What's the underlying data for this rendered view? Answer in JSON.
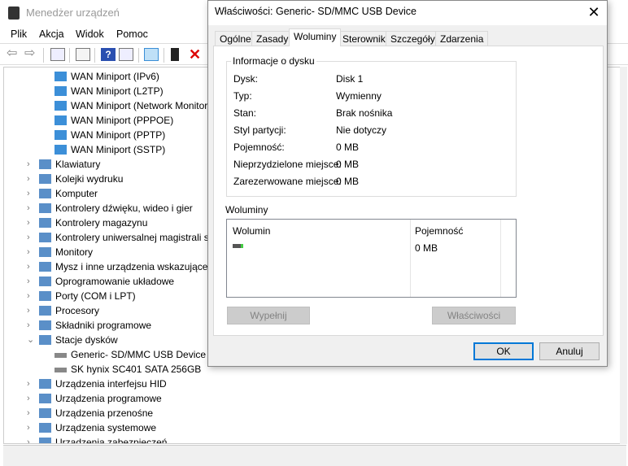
{
  "main": {
    "title": "Menedżer urządzeń",
    "menu": [
      "Plik",
      "Akcja",
      "Widok",
      "Pomoc"
    ],
    "toolbar_icons": [
      "back-icon",
      "forward-icon",
      "show-hide-tree-icon",
      "properties-icon",
      "help-icon",
      "action-pane-icon",
      "scan-hardware-icon",
      "update-driver-icon",
      "uninstall-icon"
    ],
    "tree": [
      {
        "label": "WAN Miniport (IPv6)",
        "level": 2
      },
      {
        "label": "WAN Miniport (L2TP)",
        "level": 2
      },
      {
        "label": "WAN Miniport (Network Monitor)",
        "level": 2
      },
      {
        "label": "WAN Miniport (PPPOE)",
        "level": 2
      },
      {
        "label": "WAN Miniport (PPTP)",
        "level": 2
      },
      {
        "label": "WAN Miniport (SSTP)",
        "level": 2
      },
      {
        "label": "Klawiatury",
        "level": 1,
        "expanded": false
      },
      {
        "label": "Kolejki wydruku",
        "level": 1,
        "expanded": false
      },
      {
        "label": "Komputer",
        "level": 1,
        "expanded": false
      },
      {
        "label": "Kontrolery dźwięku, wideo i gier",
        "level": 1,
        "expanded": false
      },
      {
        "label": "Kontrolery magazynu",
        "level": 1,
        "expanded": false
      },
      {
        "label": "Kontrolery uniwersalnej magistrali szeregowej",
        "level": 1,
        "expanded": false
      },
      {
        "label": "Monitory",
        "level": 1,
        "expanded": false
      },
      {
        "label": "Mysz i inne urządzenia wskazujące",
        "level": 1,
        "expanded": false
      },
      {
        "label": "Oprogramowanie układowe",
        "level": 1,
        "expanded": false
      },
      {
        "label": "Porty (COM i LPT)",
        "level": 1,
        "expanded": false
      },
      {
        "label": "Procesory",
        "level": 1,
        "expanded": false
      },
      {
        "label": "Składniki programowe",
        "level": 1,
        "expanded": false
      },
      {
        "label": "Stacje dysków",
        "level": 1,
        "expanded": true
      },
      {
        "label": "Generic- SD/MMC USB Device",
        "level": 2
      },
      {
        "label": "SK hynix SC401 SATA 256GB",
        "level": 2
      },
      {
        "label": "Urządzenia interfejsu HID",
        "level": 1,
        "expanded": false
      },
      {
        "label": "Urządzenia programowe",
        "level": 1,
        "expanded": false
      },
      {
        "label": "Urządzenia przenośne",
        "level": 1,
        "expanded": false
      },
      {
        "label": "Urządzenia systemowe",
        "level": 1,
        "expanded": false
      },
      {
        "label": "Urządzenia zabezpieczeń",
        "level": 1,
        "expanded": false
      }
    ]
  },
  "dialog": {
    "title": "Właściwości: Generic- SD/MMC USB Device",
    "tabs": [
      "Ogólne",
      "Zasady",
      "Woluminy",
      "Sterownik",
      "Szczegóły",
      "Zdarzenia"
    ],
    "active_tab": "Woluminy",
    "disk_info": {
      "legend": "Informacje o dysku",
      "rows": [
        {
          "label": "Dysk:",
          "value": "Disk 1"
        },
        {
          "label": "Typ:",
          "value": "Wymienny"
        },
        {
          "label": "Stan:",
          "value": "Brak nośnika"
        },
        {
          "label": "Styl partycji:",
          "value": "Nie dotyczy"
        },
        {
          "label": "Pojemność:",
          "value": "0 MB"
        },
        {
          "label": "Nieprzydzielone miejsce:",
          "value": "0 MB"
        },
        {
          "label": "Zarezerwowane miejsce:",
          "value": "0 MB"
        }
      ]
    },
    "volumes": {
      "label": "Woluminy",
      "columns": [
        "Wolumin",
        "Pojemność"
      ],
      "rows": [
        {
          "volume": "",
          "capacity": "0 MB"
        }
      ]
    },
    "populate_button": "Wypełnij",
    "properties_button": "Właściwości",
    "ok_button": "OK",
    "cancel_button": "Anuluj"
  }
}
